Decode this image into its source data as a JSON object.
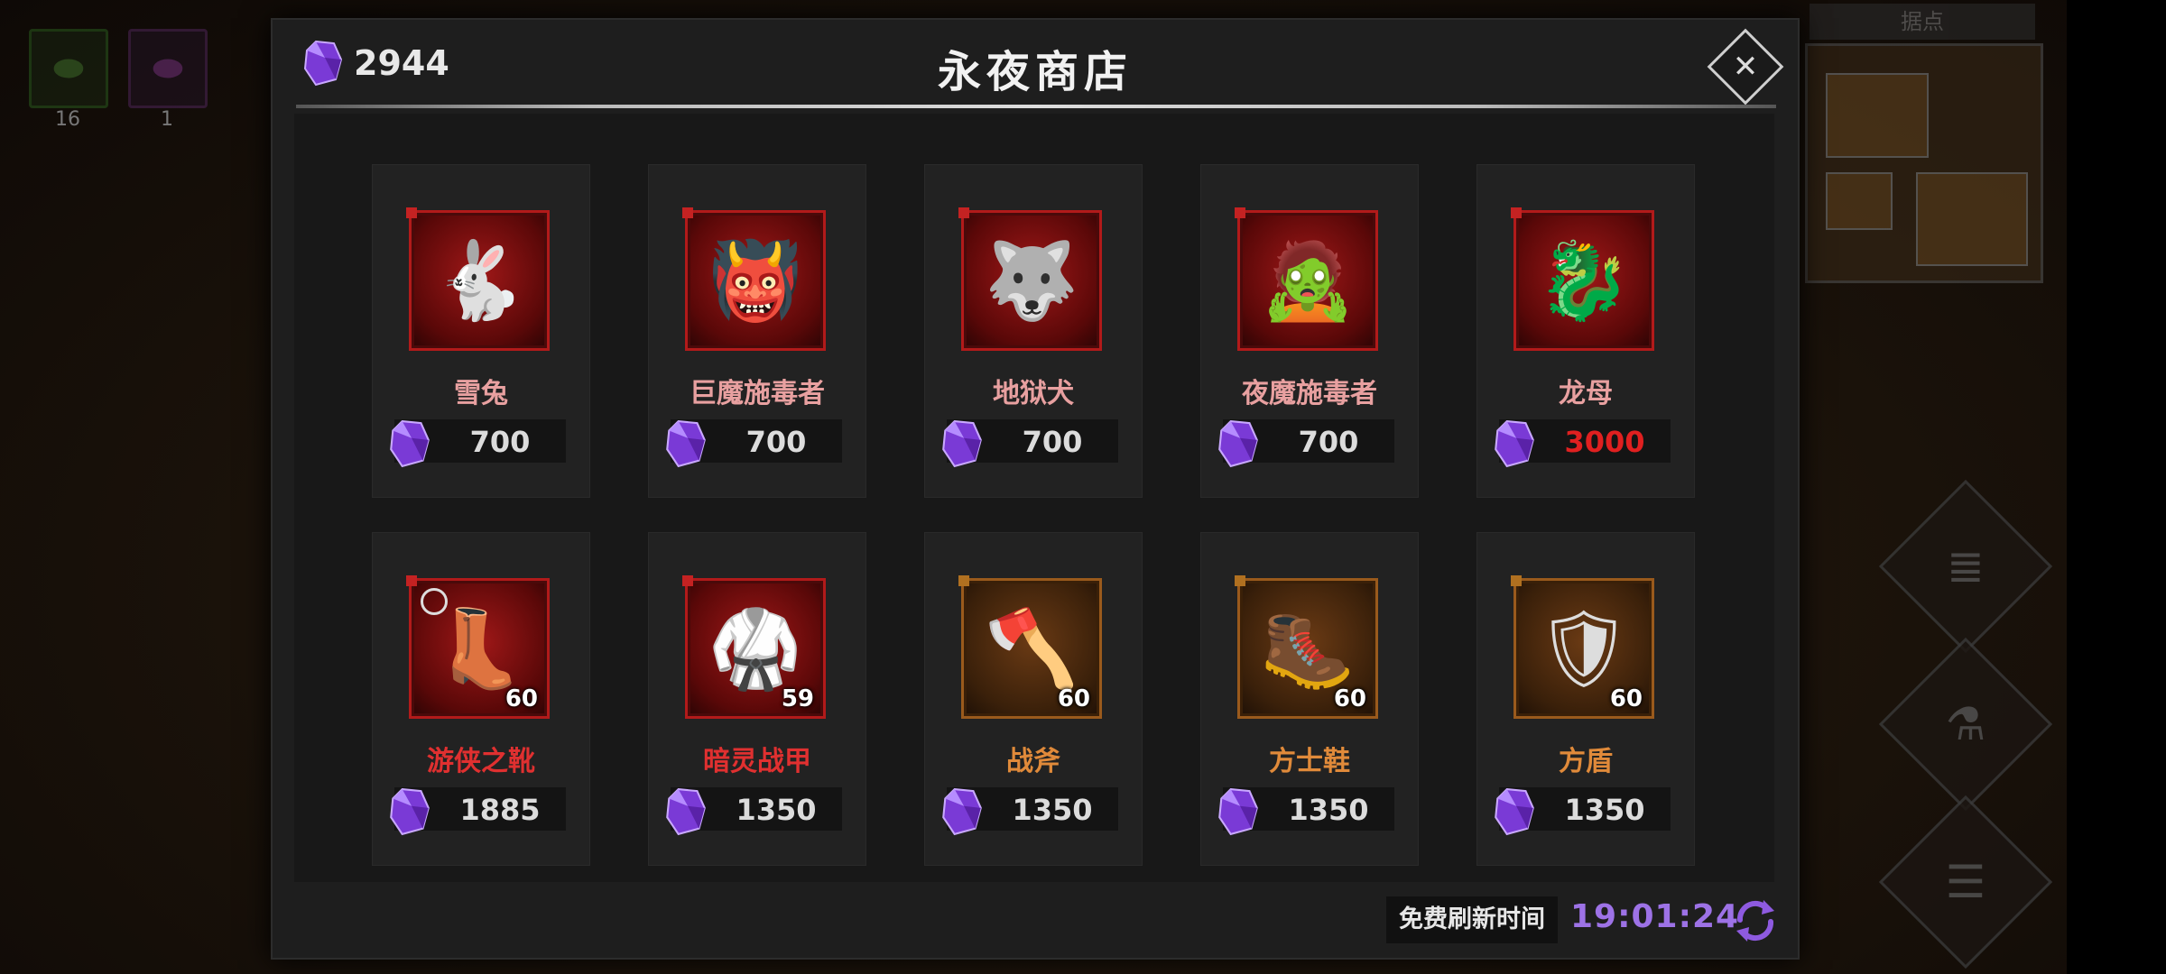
{
  "background": {
    "slots": [
      {
        "icon": "green-pouch-icon",
        "count": "16",
        "color": "#3c7a2a"
      },
      {
        "icon": "purple-pouch-icon",
        "count": "1",
        "color": "#6a2c7a"
      }
    ],
    "minimap_label": "据点"
  },
  "shop": {
    "title": "永夜商店",
    "currency": {
      "icon": "purple-gem-icon",
      "amount": "2944"
    },
    "close_icon": "close-icon",
    "items": [
      {
        "name": "雪兔",
        "price": "700",
        "name_color": "#e8a0a0",
        "price_color": "#dcdcdc",
        "frame": "red",
        "art": "🐇",
        "level": ""
      },
      {
        "name": "巨魔施毒者",
        "price": "700",
        "name_color": "#e8a0a0",
        "price_color": "#dcdcdc",
        "frame": "red",
        "art": "👹",
        "level": ""
      },
      {
        "name": "地狱犬",
        "price": "700",
        "name_color": "#e8a0a0",
        "price_color": "#dcdcdc",
        "frame": "red",
        "art": "🐺",
        "level": ""
      },
      {
        "name": "夜魔施毒者",
        "price": "700",
        "name_color": "#e8a0a0",
        "price_color": "#dcdcdc",
        "frame": "red",
        "art": "🧟",
        "level": ""
      },
      {
        "name": "龙母",
        "price": "3000",
        "name_color": "#e8a0a0",
        "price_color": "#e02020",
        "frame": "red",
        "art": "🐉",
        "level": ""
      },
      {
        "name": "游侠之靴",
        "price": "1885",
        "name_color": "#e03030",
        "price_color": "#dcdcdc",
        "frame": "red",
        "art": "👢",
        "level": "60",
        "ring": true
      },
      {
        "name": "暗灵战甲",
        "price": "1350",
        "name_color": "#e03030",
        "price_color": "#dcdcdc",
        "frame": "red",
        "art": "🥋",
        "level": "59"
      },
      {
        "name": "战斧",
        "price": "1350",
        "name_color": "#e08a3a",
        "price_color": "#dcdcdc",
        "frame": "bronze",
        "art": "🪓",
        "level": "60"
      },
      {
        "name": "方士鞋",
        "price": "1350",
        "name_color": "#e08a3a",
        "price_color": "#dcdcdc",
        "frame": "bronze",
        "art": "🥾",
        "level": "60"
      },
      {
        "name": "方盾",
        "price": "1350",
        "name_color": "#e08a3a",
        "price_color": "#dcdcdc",
        "frame": "bronze",
        "art": "🛡",
        "level": "60"
      }
    ],
    "refresh": {
      "label": "免费刷新时间",
      "timer": "19:01:24",
      "icon": "refresh-icon"
    },
    "colors": {
      "gem": "#8a4ae0",
      "timer": "#9d72e6"
    }
  },
  "side_buttons": [
    {
      "icon": "scroll-icon",
      "glyph": "📜"
    },
    {
      "icon": "potion-icon",
      "glyph": "⚗"
    },
    {
      "icon": "menu-list-icon",
      "glyph": "☰"
    }
  ]
}
